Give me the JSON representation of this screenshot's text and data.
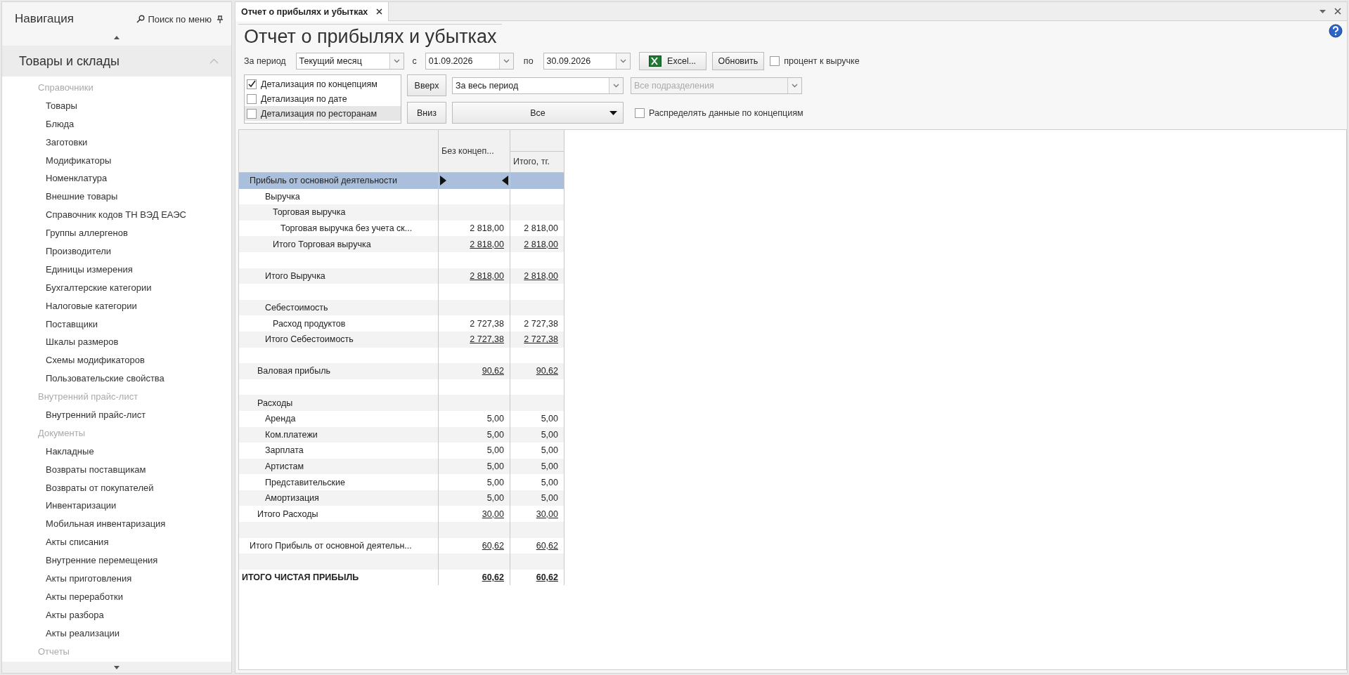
{
  "sidebar": {
    "title": "Навигация",
    "search": "Поиск по меню",
    "group": {
      "label": "Товары и склады",
      "expanded": true
    },
    "sections": [
      {
        "label": "Справочники",
        "items": [
          "Товары",
          "Блюда",
          "Заготовки",
          "Модификаторы",
          "Номенклатура",
          "Внешние товары",
          "Справочник кодов ТН ВЭД ЕАЭС",
          "Группы аллергенов",
          "Производители",
          "Единицы измерения",
          "Бухгалтерские категории",
          "Налоговые категории",
          "Поставщики",
          "Шкалы размеров",
          "Схемы модификаторов",
          "Пользовательские свойства"
        ]
      },
      {
        "label": "Внутренний прайс-лист",
        "items": [
          "Внутренний прайс-лист"
        ]
      },
      {
        "label": "Документы",
        "items": [
          "Накладные",
          "Возвраты поставщикам",
          "Возвраты от покупателей",
          "Инвентаризации",
          "Мобильная инвентаризация",
          "Акты списания",
          "Внутренние перемещения",
          "Акты приготовления",
          "Акты переработки",
          "Акты разбора",
          "Акты реализации"
        ]
      },
      {
        "label": "Отчеты"
      }
    ]
  },
  "tab": {
    "label": "Отчет о прибылях и убытках",
    "selected": true
  },
  "title": "Отчет о прибылях и убытках",
  "toolbar": {
    "period_label": "За период",
    "period": "Текущий месяц",
    "from_label": "с",
    "from": "01.09.2026",
    "to_label": "по",
    "to": "30.09.2026",
    "excel": "Excel...",
    "refresh": "Обновить",
    "percent": {
      "label": "процент к выручке",
      "checked": false
    }
  },
  "details": [
    {
      "label": "Детализация по концепциям",
      "checked": true,
      "selected": false
    },
    {
      "label": "Детализация по дате",
      "checked": false,
      "selected": false
    },
    {
      "label": "Детализация по ресторанам",
      "checked": false,
      "selected": true
    }
  ],
  "up_button": "Вверх",
  "down_button": "Вниз",
  "range": "За весь период",
  "departments": {
    "value": "Все подразделения",
    "disabled": true
  },
  "filter": "Все",
  "distribute": {
    "label": "Распределять данные по концепциям",
    "checked": false
  },
  "report": {
    "columns": [
      {
        "label": "Без концеп...",
        "band": false
      },
      {
        "label": "Итого, тг.",
        "band": true
      }
    ],
    "rows": [
      {
        "children": [
          {
            "label": "Прибыль от основной деятельности",
            "selected": true,
            "children": [
              {
                "children": [
                  {
                    "label": "Выручка",
                    "selected": false,
                    "children": [
                      {
                        "label": "Торговая выручка",
                        "selected": false,
                        "children": [
                          {
                            "label": "Торговая выручка без учета ск...",
                            "selected": false,
                            "values": [
                              "2 818,00",
                              "2 818,00"
                            ]
                          }
                        ],
                        "total": {
                          "label": "Итого Торговая выручка",
                          "selected": false,
                          "values": [
                            "2 818,00",
                            "2 818,00"
                          ]
                        }
                      }
                    ],
                    "total": {
                      "label": "Итого Выручка",
                      "selected": false,
                      "values": [
                        "2 818,00",
                        "2 818,00"
                      ]
                    }
                  },
                  {
                    "label": "Себестоимость",
                    "selected": false,
                    "children": [
                      {
                        "label": "Расход продуктов",
                        "selected": false,
                        "values": [
                          "2 727,38",
                          "2 727,38"
                        ]
                      }
                    ],
                    "total": {
                      "label": "Итого Себестоимость",
                      "selected": false,
                      "values": [
                        "2 727,38",
                        "2 727,38"
                      ]
                    }
                  }
                ],
                "total": {
                  "label": "Валовая прибыль",
                  "selected": false,
                  "values": [
                    "90,62",
                    "90,62"
                  ]
                }
              },
              {
                "label": "Расходы",
                "selected": false,
                "children": [
                  {
                    "label": "Аренда",
                    "selected": false,
                    "values": [
                      "5,00",
                      "5,00"
                    ]
                  },
                  {
                    "label": "Ком.платежи",
                    "selected": false,
                    "values": [
                      "5,00",
                      "5,00"
                    ]
                  },
                  {
                    "label": "Зарплата",
                    "selected": false,
                    "values": [
                      "5,00",
                      "5,00"
                    ]
                  },
                  {
                    "label": "Артистам",
                    "selected": false,
                    "values": [
                      "5,00",
                      "5,00"
                    ]
                  },
                  {
                    "label": "Представительские",
                    "selected": false,
                    "values": [
                      "5,00",
                      "5,00"
                    ]
                  },
                  {
                    "label": "Амортизация",
                    "selected": false,
                    "values": [
                      "5,00",
                      "5,00"
                    ]
                  }
                ],
                "total": {
                  "label": "Итого Расходы",
                  "selected": false,
                  "values": [
                    "30,00",
                    "30,00"
                  ]
                }
              }
            ],
            "total": {
              "label": "Итого Прибыль от основной деятельн...",
              "selected": false,
              "values": [
                "60,62",
                "60,62"
              ]
            }
          }
        ],
        "total": {
          "label": "ИТОГО ЧИСТАЯ ПРИБЫЛЬ",
          "selected": false,
          "values": [
            "60,62",
            "60,62"
          ]
        }
      }
    ]
  }
}
